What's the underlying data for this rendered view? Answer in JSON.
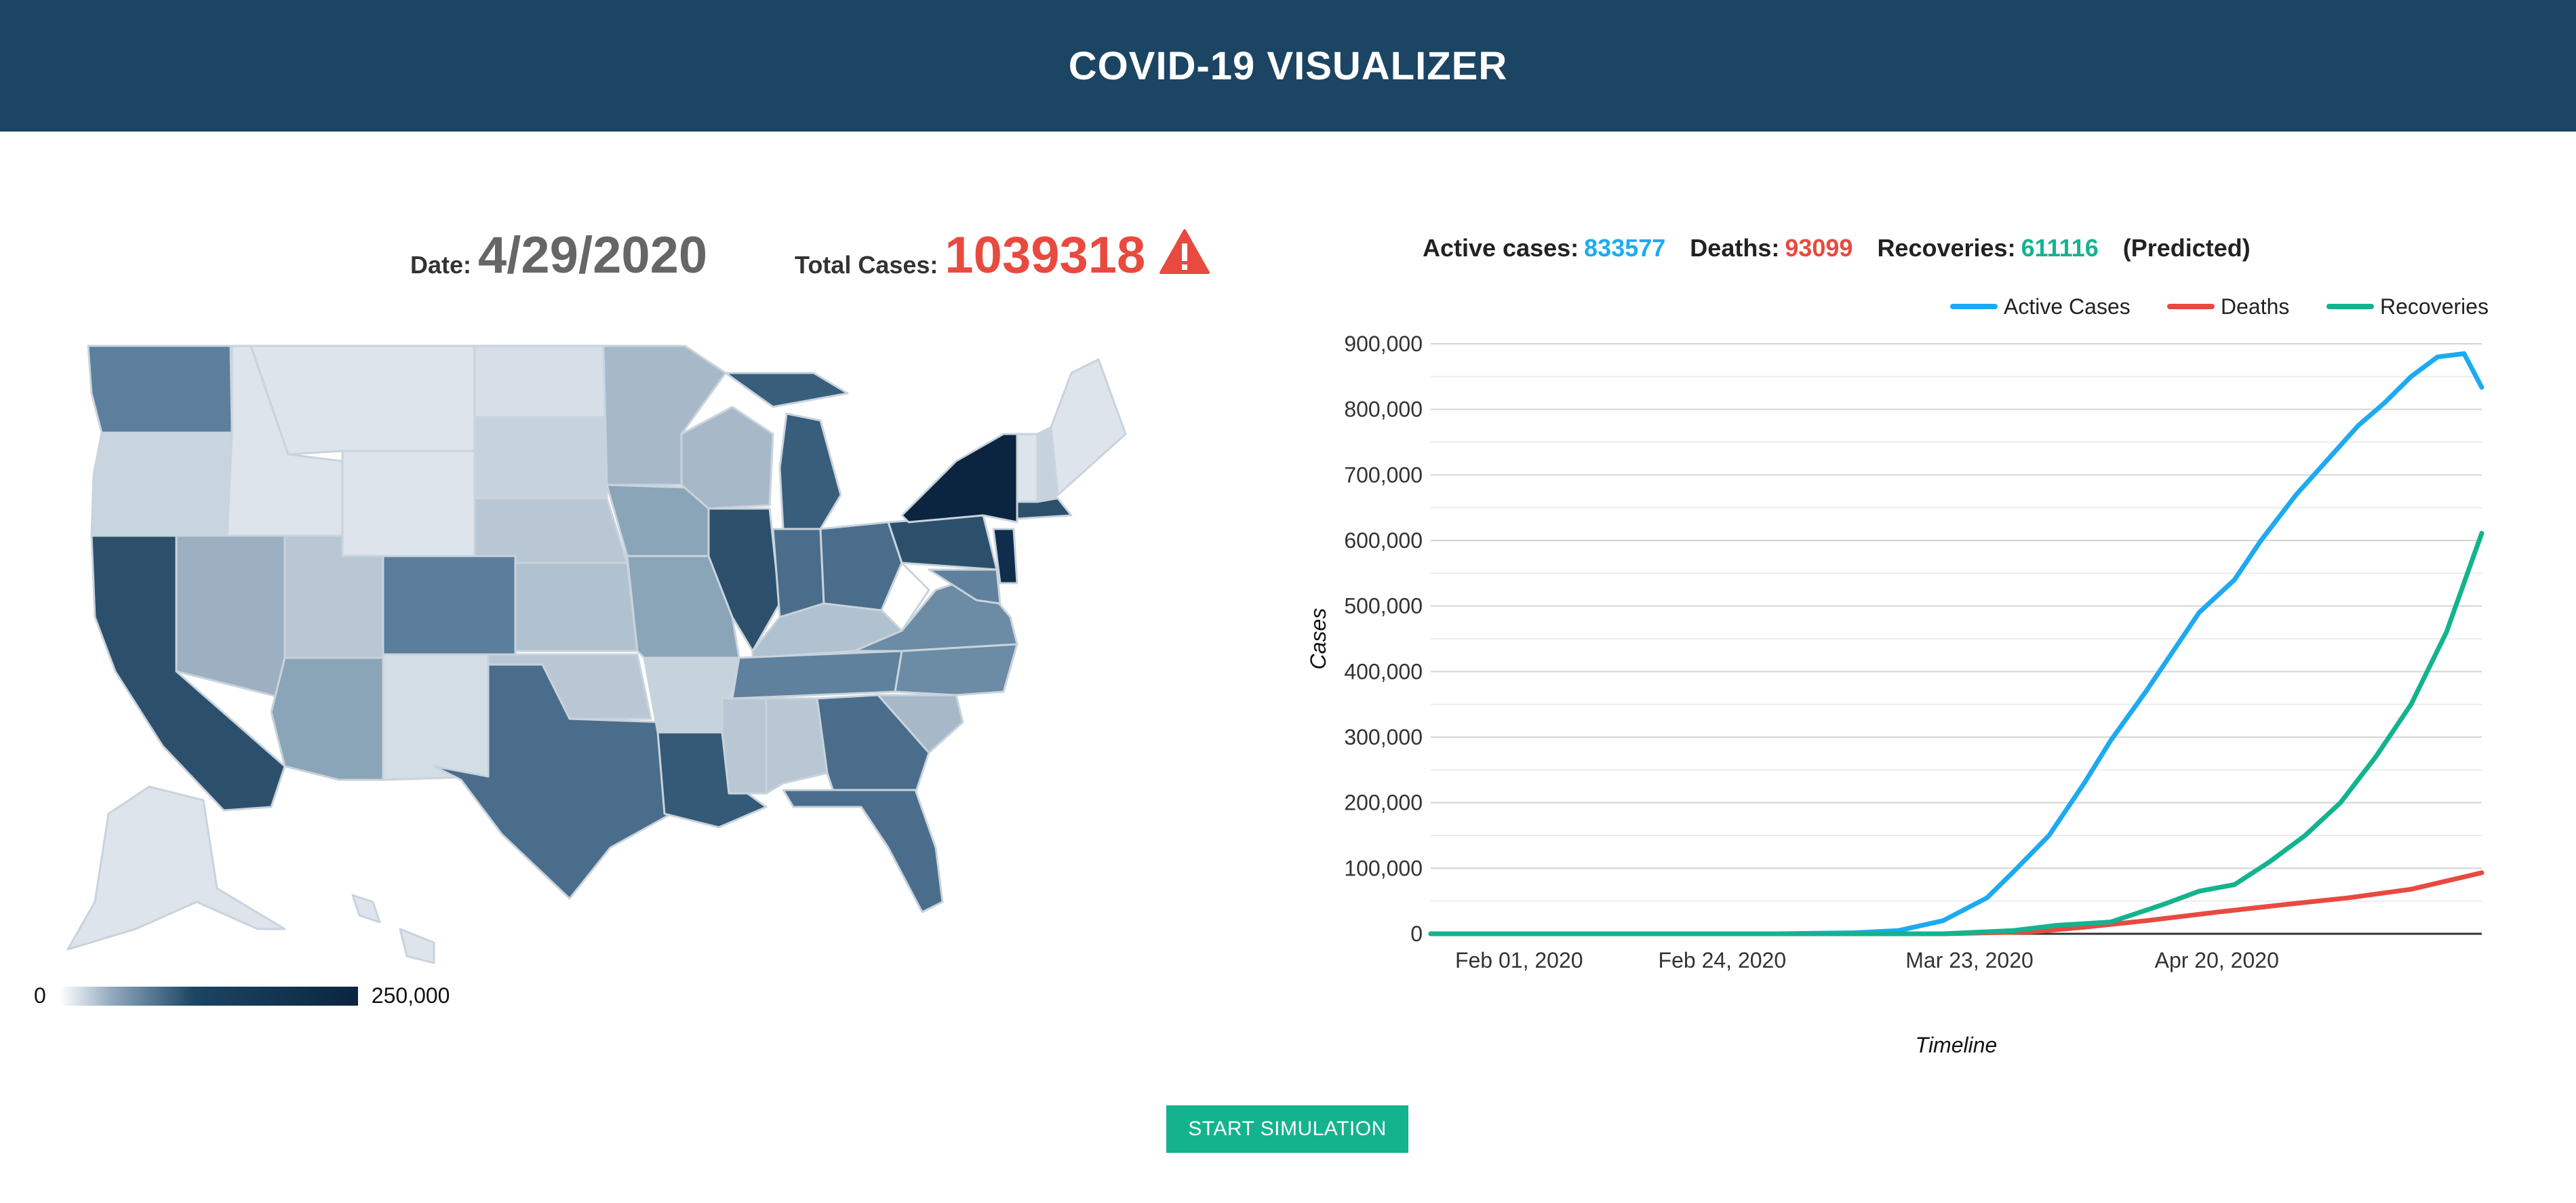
{
  "header": {
    "title": "COVID-19 VISUALIZER"
  },
  "summary": {
    "date_label": "Date:",
    "date_value": "4/29/2020",
    "total_label": "Total Cases:",
    "total_value": "1039318",
    "warning_icon": "warning-triangle-icon"
  },
  "stats": {
    "active_label": "Active cases:",
    "active_value": "833577",
    "deaths_label": "Deaths:",
    "deaths_value": "93099",
    "recoveries_label": "Recoveries:",
    "recoveries_value": "611116",
    "predicted_label": "(Predicted)"
  },
  "map_legend": {
    "min_label": "0",
    "max_label": "250,000"
  },
  "colors": {
    "header_bg": "#1b4563",
    "active": "#1eaaf1",
    "deaths": "#e84a3f",
    "recoveries": "#14b38e",
    "button": "#14b38e"
  },
  "chart_data": {
    "type": "line",
    "xlabel": "Timeline",
    "ylabel": "Cases",
    "ylim": [
      0,
      900000
    ],
    "y_ticks": [
      0,
      100000,
      200000,
      300000,
      400000,
      500000,
      600000,
      700000,
      800000,
      900000
    ],
    "y_tick_labels": [
      "0",
      "100,000",
      "200,000",
      "300,000",
      "400,000",
      "500,000",
      "600,000",
      "700,000",
      "800,000",
      "900,000"
    ],
    "x_tick_labels": [
      "Feb 01, 2020",
      "Feb 24, 2020",
      "Mar 23, 2020",
      "Apr 20, 2020"
    ],
    "x_tick_dates": [
      "2020-02-01",
      "2020-02-24",
      "2020-03-23",
      "2020-04-20"
    ],
    "xlim": [
      "2020-01-22",
      "2020-05-20"
    ],
    "legend_position": "top-right",
    "grid": true,
    "series": [
      {
        "name": "Active Cases",
        "color": "#1eaaf1",
        "points": [
          [
            "2020-01-22",
            0
          ],
          [
            "2020-03-01",
            0
          ],
          [
            "2020-03-10",
            1500
          ],
          [
            "2020-03-15",
            5000
          ],
          [
            "2020-03-20",
            20000
          ],
          [
            "2020-03-25",
            55000
          ],
          [
            "2020-03-28",
            95000
          ],
          [
            "2020-04-01",
            150000
          ],
          [
            "2020-04-05",
            230000
          ],
          [
            "2020-04-08",
            295000
          ],
          [
            "2020-04-12",
            370000
          ],
          [
            "2020-04-15",
            430000
          ],
          [
            "2020-04-18",
            490000
          ],
          [
            "2020-04-22",
            540000
          ],
          [
            "2020-04-25",
            600000
          ],
          [
            "2020-04-29",
            670000
          ],
          [
            "2020-05-03",
            730000
          ],
          [
            "2020-05-06",
            775000
          ],
          [
            "2020-05-09",
            810000
          ],
          [
            "2020-05-12",
            850000
          ],
          [
            "2020-05-15",
            880000
          ],
          [
            "2020-05-18",
            885000
          ],
          [
            "2020-05-20",
            833577
          ]
        ]
      },
      {
        "name": "Deaths",
        "color": "#e84a3f",
        "points": [
          [
            "2020-01-22",
            0
          ],
          [
            "2020-03-20",
            0
          ],
          [
            "2020-03-30",
            3000
          ],
          [
            "2020-04-05",
            10000
          ],
          [
            "2020-04-12",
            20000
          ],
          [
            "2020-04-20",
            33000
          ],
          [
            "2020-04-28",
            45000
          ],
          [
            "2020-05-05",
            55000
          ],
          [
            "2020-05-12",
            68000
          ],
          [
            "2020-05-20",
            93099
          ]
        ]
      },
      {
        "name": "Recoveries",
        "color": "#14b38e",
        "points": [
          [
            "2020-01-22",
            0
          ],
          [
            "2020-03-20",
            0
          ],
          [
            "2020-03-28",
            5000
          ],
          [
            "2020-04-02",
            13000
          ],
          [
            "2020-04-08",
            18000
          ],
          [
            "2020-04-14",
            45000
          ],
          [
            "2020-04-18",
            65000
          ],
          [
            "2020-04-22",
            75000
          ],
          [
            "2020-04-26",
            110000
          ],
          [
            "2020-04-30",
            150000
          ],
          [
            "2020-05-04",
            200000
          ],
          [
            "2020-05-08",
            270000
          ],
          [
            "2020-05-12",
            350000
          ],
          [
            "2020-05-16",
            460000
          ],
          [
            "2020-05-20",
            611116
          ]
        ]
      }
    ]
  }
}
